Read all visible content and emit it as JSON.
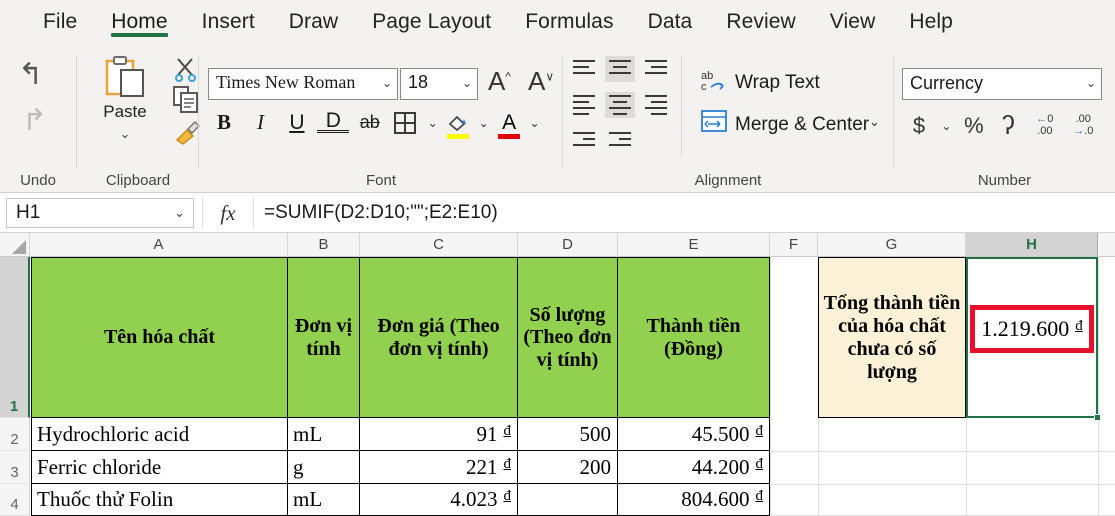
{
  "ribbon": {
    "tabs": [
      {
        "label": "File",
        "active": false
      },
      {
        "label": "Home",
        "active": true
      },
      {
        "label": "Insert",
        "active": false
      },
      {
        "label": "Draw",
        "active": false
      },
      {
        "label": "Page Layout",
        "active": false
      },
      {
        "label": "Formulas",
        "active": false
      },
      {
        "label": "Data",
        "active": false
      },
      {
        "label": "Review",
        "active": false
      },
      {
        "label": "View",
        "active": false
      },
      {
        "label": "Help",
        "active": false
      }
    ],
    "groups": {
      "undo": {
        "title": "Undo",
        "undo_icon": "undo-arrow-icon",
        "redo_icon": "redo-arrow-icon"
      },
      "clipboard": {
        "title": "Clipboard",
        "paste_label": "Paste",
        "paste_chevron": "⌄",
        "cut_icon": "scissors-icon",
        "copy_icon": "copy-icon",
        "format_painter_icon": "format-painter-icon"
      },
      "font": {
        "title": "Font",
        "font_name": "Times New Roman",
        "font_size": "18",
        "grow_font": "A",
        "shrink_font": "A",
        "bold": "B",
        "italic": "I",
        "underline": "U",
        "double_underline": "D",
        "strikethrough": "ab",
        "borders_icon": "borders-grid-icon",
        "fill_color_icon": "fill-color-icon",
        "fill_color_swatch": "#ffff00",
        "font_color_icon": "font-color-icon",
        "font_color_swatch": "#e00000",
        "chevron": "⌄"
      },
      "alignment": {
        "title": "Alignment",
        "wrap_text": "Wrap Text",
        "wrap_icon": "wrap-text-icon",
        "merge_center": "Merge & Center",
        "merge_icon": "merge-center-icon",
        "merge_chevron": "⌄"
      },
      "number": {
        "title": "Number",
        "format": "Currency",
        "currency": "$",
        "currency_chevron": "⌄",
        "percent": "%",
        "comma": "ʔ",
        "increase_decimal_icon": "increase-decimal-icon",
        "decrease_decimal_icon": "decrease-decimal-icon"
      }
    }
  },
  "formula_bar": {
    "name_box": "H1",
    "name_box_chevron": "⌄",
    "fx_label": "fx",
    "formula": "=SUMIF(D2:D10;\"\";E2:E10)"
  },
  "grid": {
    "column_headers": [
      "A",
      "B",
      "C",
      "D",
      "E",
      "F",
      "G",
      "H"
    ],
    "selected_column": "H",
    "row_headers": [
      "1",
      "2",
      "3",
      "4"
    ],
    "selected_row": "1",
    "header_row": {
      "A": "Tên hóa chất",
      "B": "Đơn vị tính",
      "C": "Đơn giá (Theo đơn vị tính)",
      "D": "Số lượng (Theo đơn vị tính)",
      "E": "Thành tiền (Đồng)",
      "G": "Tổng thành tiền của hóa chất chưa có số lượng",
      "H": "1.219.600",
      "H_currency": "đ"
    },
    "rows": [
      {
        "row": "2",
        "A": "Hydrochloric acid",
        "B": "mL",
        "C": "91",
        "C_currency": "đ",
        "D": "500",
        "E": "45.500",
        "E_currency": "đ"
      },
      {
        "row": "3",
        "A": "Ferric chloride",
        "B": "g",
        "C": "221",
        "C_currency": "đ",
        "D": "200",
        "E": "44.200",
        "E_currency": "đ"
      },
      {
        "row": "4",
        "A": "Thuốc thử Folin",
        "B": "mL",
        "C": "4.023",
        "C_currency": "đ",
        "D": "",
        "E": "804.600",
        "E_currency": "đ"
      }
    ]
  },
  "colors": {
    "header_green": "#92d050",
    "note_beige": "#fdf2d8",
    "selection_green": "#217346",
    "highlight_red": "#e8112d"
  }
}
